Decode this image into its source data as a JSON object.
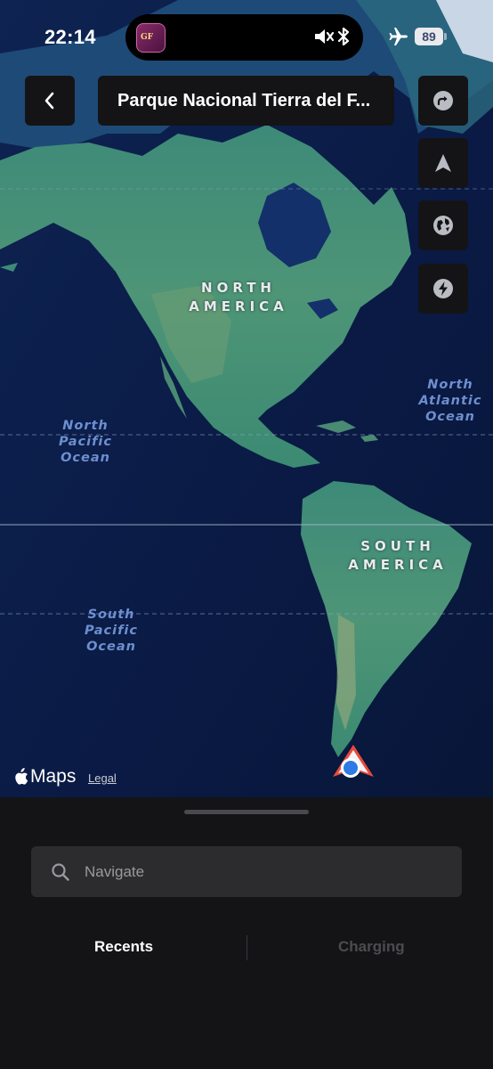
{
  "status_bar": {
    "time": "22:14",
    "battery_level": "89",
    "island_app_label": "GF",
    "icons": [
      "app-thumbnail-icon",
      "mute-icon",
      "bluetooth-icon",
      "airplane-mode-icon",
      "battery-icon"
    ]
  },
  "header": {
    "back_icon": "chevron-left-icon",
    "destination_title": "Parque Nacional Tierra del F..."
  },
  "map_controls": [
    {
      "name": "reroute-button",
      "icon": "redo-arrow-icon"
    },
    {
      "name": "recenter-button",
      "icon": "navigation-arrow-icon"
    },
    {
      "name": "map-style-button",
      "icon": "globe-icon"
    },
    {
      "name": "charging-button",
      "icon": "lightning-bolt-icon"
    }
  ],
  "map": {
    "continents": [
      {
        "line1": "NORTH",
        "line2": "AMERICA"
      },
      {
        "line1": "SOUTH",
        "line2": "AMERICA"
      }
    ],
    "oceans": [
      {
        "lines": [
          "North",
          "Pacific",
          "Ocean"
        ]
      },
      {
        "lines": [
          "North",
          "Atlantic",
          "Ocean"
        ]
      },
      {
        "lines": [
          "South",
          "Pacific",
          "Ocean"
        ]
      }
    ],
    "attribution": "Maps",
    "legal_link": "Legal",
    "colors": {
      "ocean": "#0d1f4a",
      "deep_ocean": "#0a1840",
      "land": "#3f8f7c",
      "land_dry": "#6f9e74",
      "ice": "#c8d6e6"
    }
  },
  "bottom_sheet": {
    "search_placeholder": "Navigate",
    "tabs": [
      {
        "label": "Recents",
        "active": true
      },
      {
        "label": "Charging",
        "active": false
      }
    ]
  },
  "colors": {
    "panel_background": "#141416",
    "search_background": "#2c2c2e",
    "location_accent": "#e84a3c",
    "location_dot": "#2f7ae5"
  }
}
